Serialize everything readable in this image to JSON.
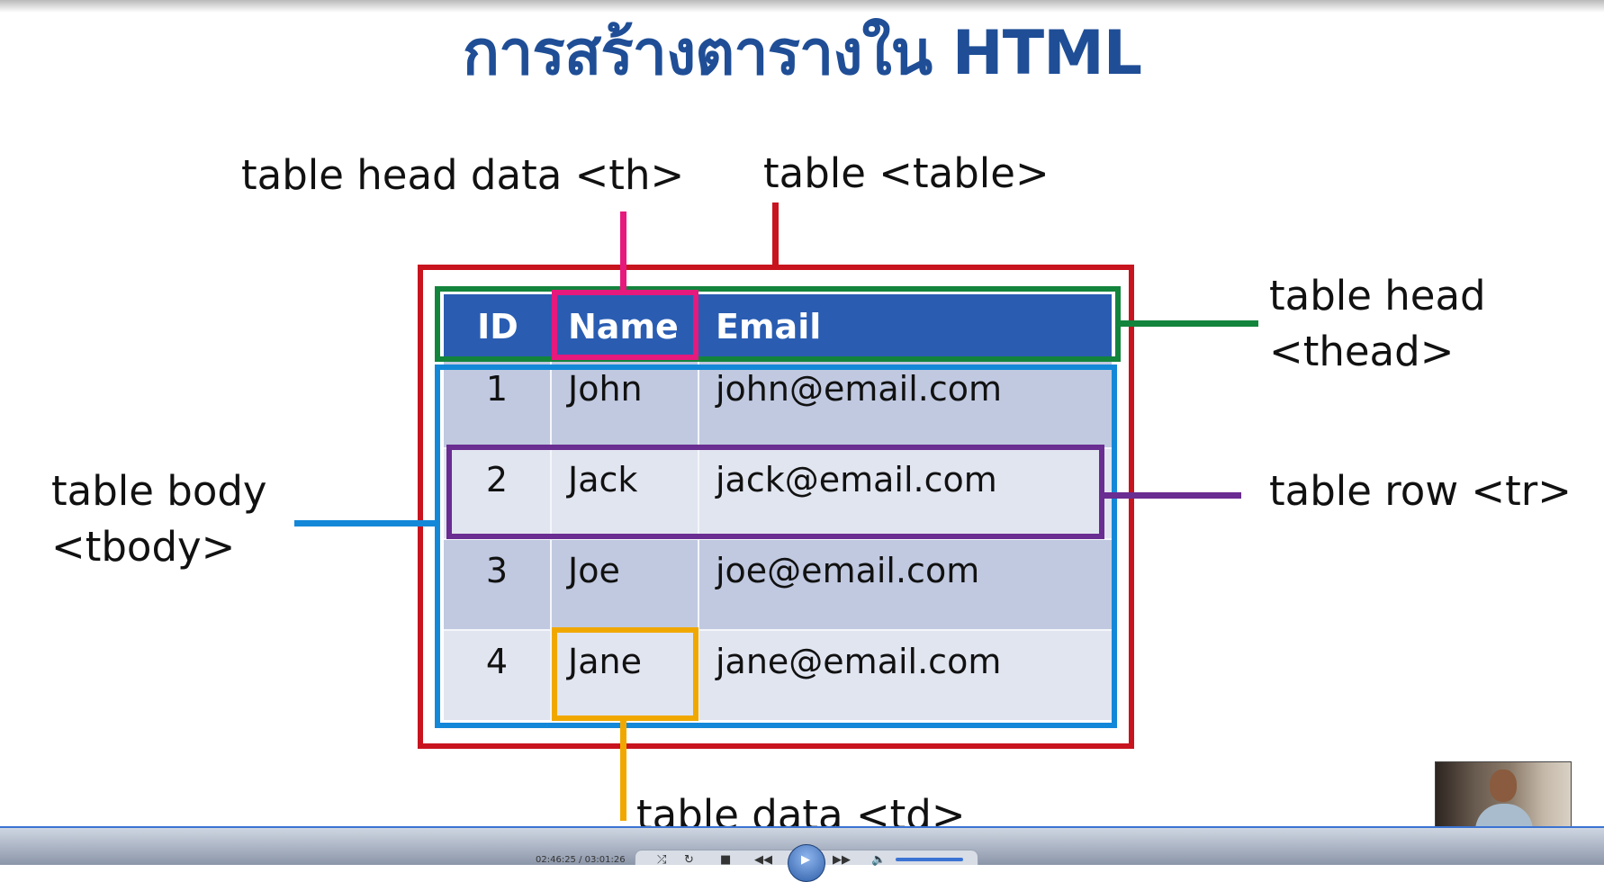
{
  "slide": {
    "title": "การสร้างตารางใน HTML",
    "labels": {
      "th": "table head data <th>",
      "table": "table <table>",
      "thead_line1": "table head",
      "thead_line2": "<thead>",
      "tbody_line1": "table body",
      "tbody_line2": "<tbody>",
      "tr": "table row <tr>",
      "td": "table data <td>"
    },
    "table": {
      "headers": [
        "ID",
        "Name",
        "Email"
      ],
      "rows": [
        [
          "1",
          "John",
          "john@email.com"
        ],
        [
          "2",
          "Jack",
          "jack@email.com"
        ],
        [
          "3",
          "Joe",
          "joe@email.com"
        ],
        [
          "4",
          "Jane",
          "jane@email.com"
        ]
      ]
    },
    "colors": {
      "table": "#c8141e",
      "thead": "#13843c",
      "th": "#e6197d",
      "tbody": "#1488d8",
      "tr": "#6a2d91",
      "td": "#f0a800",
      "header_bg": "#2a5db2",
      "title": "#1f4e96"
    }
  },
  "player": {
    "time": "02:46:25 / 03:01:26",
    "icons": [
      "shuffle-icon",
      "repeat-icon",
      "stop-icon",
      "rewind-icon",
      "play-icon",
      "fast-forward-icon",
      "volume-icon"
    ]
  }
}
